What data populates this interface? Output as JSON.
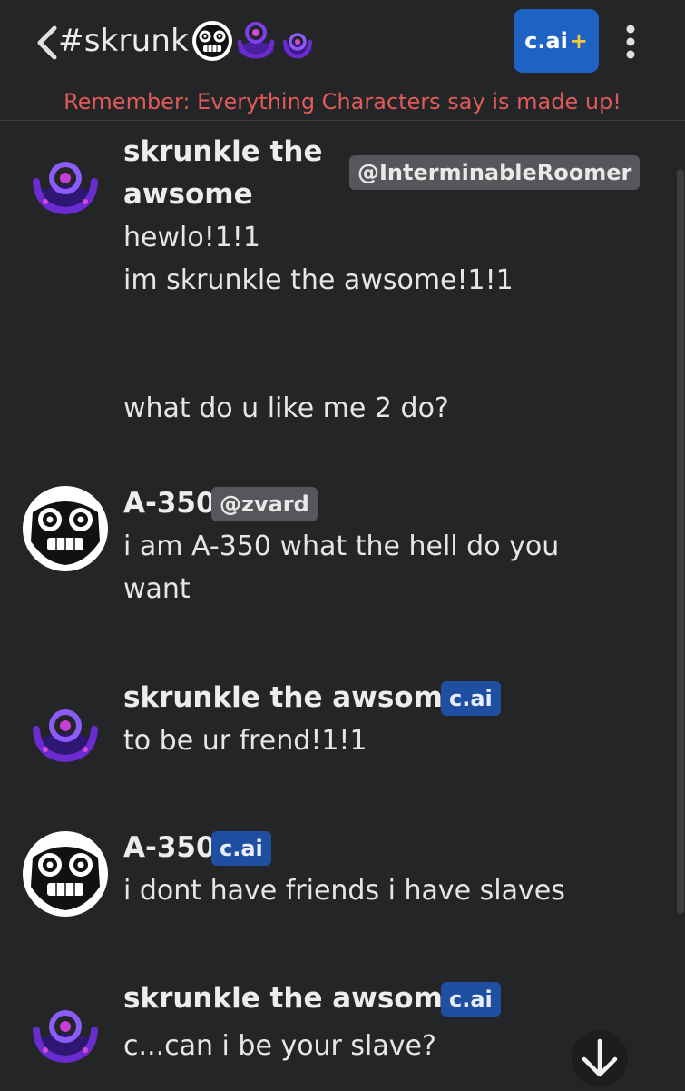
{
  "header": {
    "room_title": "#skrunk",
    "plus_button": {
      "label": "c.ai",
      "plus": "+"
    }
  },
  "disclaimer": "Remember: Everything Characters say is made up!",
  "messages": [
    {
      "name": "skrunkle the awsome",
      "tag": "@InterminableRoomer",
      "text": "hewlo!1!1\nim skrunkle the awsome!1!1\n\n\nwhat do u like me 2 do?"
    },
    {
      "name": "A-350",
      "tag": "@zvard",
      "text": "i am A-350 what the hell do you\nwant"
    },
    {
      "name": "skrunkle the awsome",
      "tag": "c.ai",
      "text": "to be ur frend!1!1"
    },
    {
      "name": "A-350",
      "tag": "c.ai",
      "text": "i dont have friends i have slaves"
    },
    {
      "name": "skrunkle the awsome",
      "tag": "c.ai",
      "text": "c...can i be your slave?"
    }
  ],
  "colors": {
    "background": "#242526",
    "accent": "#1e63c4",
    "disclaimer": "#e05a5a"
  }
}
